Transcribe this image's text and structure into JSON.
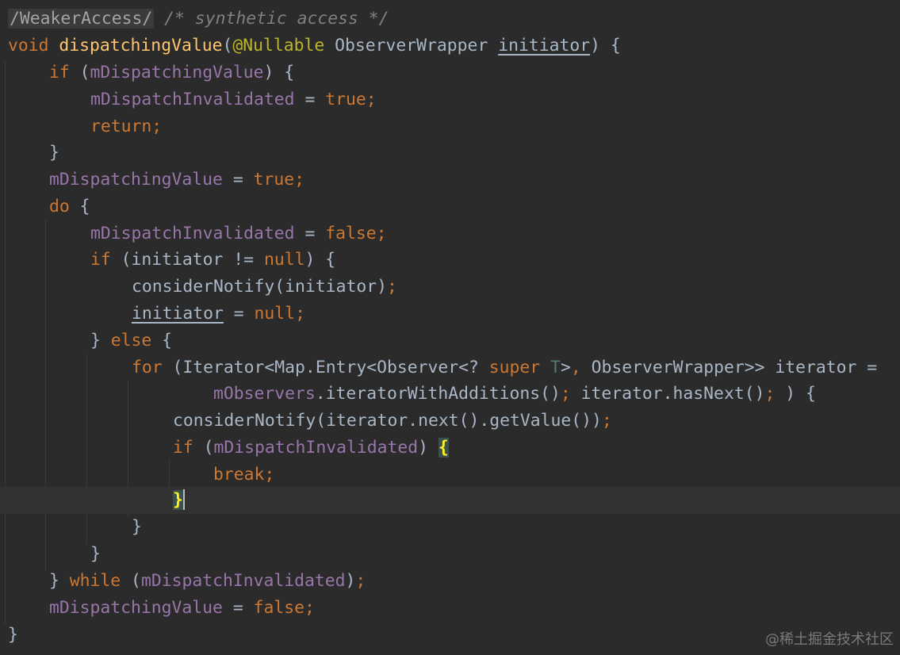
{
  "colors": {
    "background": "#2b2b2b",
    "current_line": "#323232",
    "keyword": "#cc7832",
    "function": "#ffc66d",
    "field": "#9876aa",
    "comment": "#808080",
    "annotation": "#bbb529",
    "type_parameter": "#507874",
    "default_text": "#a9b7c6",
    "brace_match": "#ffef28"
  },
  "code": {
    "l1": {
      "annot": "/WeakerAccess/",
      "comment": " /* synthetic access */"
    },
    "l2": {
      "kw": "void",
      "fn": "dispatchingValue",
      "p1": "(",
      "annot": "@Nullable",
      "type": " ObserverWrapper ",
      "param": "initiator",
      "p2": ") {"
    },
    "l3": {
      "kw": "if",
      "p1": " (",
      "field": "mDispatchingValue",
      "p2": ") {"
    },
    "l4": {
      "field": "mDispatchInvalidated",
      "op": " = ",
      "kw": "true",
      "semi": ";"
    },
    "l5": {
      "kw": "return",
      "semi": ";"
    },
    "l6": {
      "text": "}"
    },
    "l7": {
      "field": "mDispatchingValue",
      "op": " = ",
      "kw": "true",
      "semi": ";"
    },
    "l8": {
      "kw": "do",
      "p": " {"
    },
    "l9": {
      "field": "mDispatchInvalidated",
      "op": " = ",
      "kw": "false",
      "semi": ";"
    },
    "l10": {
      "kw": "if",
      "p1": " (initiator != ",
      "kw2": "null",
      "p2": ") {"
    },
    "l11": {
      "call": "considerNotify(initiator)",
      "semi": ";"
    },
    "l12": {
      "var": "initiator",
      "op": " = ",
      "kw": "null",
      "semi": ";"
    },
    "l13": {
      "p1": "} ",
      "kw": "else",
      "p2": " {"
    },
    "l14": {
      "kw": "for",
      "p1": " (Iterator<Map.Entry<Observer<? ",
      "kw2": "super",
      "sp": " ",
      "tparam": "T",
      "p2": ">",
      "comma": ",",
      "p3": " ObserverWrapper>> iterator ="
    },
    "l15": {
      "field": "mObservers",
      "p1": ".iteratorWithAdditions()",
      "semi1": ";",
      "p2": " iterator.hasNext()",
      "semi2": ";",
      "p3": " ) {"
    },
    "l16": {
      "call": "considerNotify(iterator.next().getValue())",
      "semi": ";"
    },
    "l17": {
      "kw": "if",
      "p1": " (",
      "field": "mDispatchInvalidated",
      "p2": ") ",
      "brace": "{"
    },
    "l18": {
      "kw": "break",
      "semi": ";"
    },
    "l19": {
      "brace": "}"
    },
    "l20": {
      "text": "}"
    },
    "l21": {
      "text": "}"
    },
    "l22": {
      "p1": "} ",
      "kw": "while",
      "p2": " (",
      "field": "mDispatchInvalidated",
      "p3": ")",
      "semi": ";"
    },
    "l23": {
      "field": "mDispatchingValue",
      "op": " = ",
      "kw": "false",
      "semi": ";"
    },
    "l24": {
      "text": "}"
    }
  },
  "watermark": "@稀土掘金技术社区"
}
